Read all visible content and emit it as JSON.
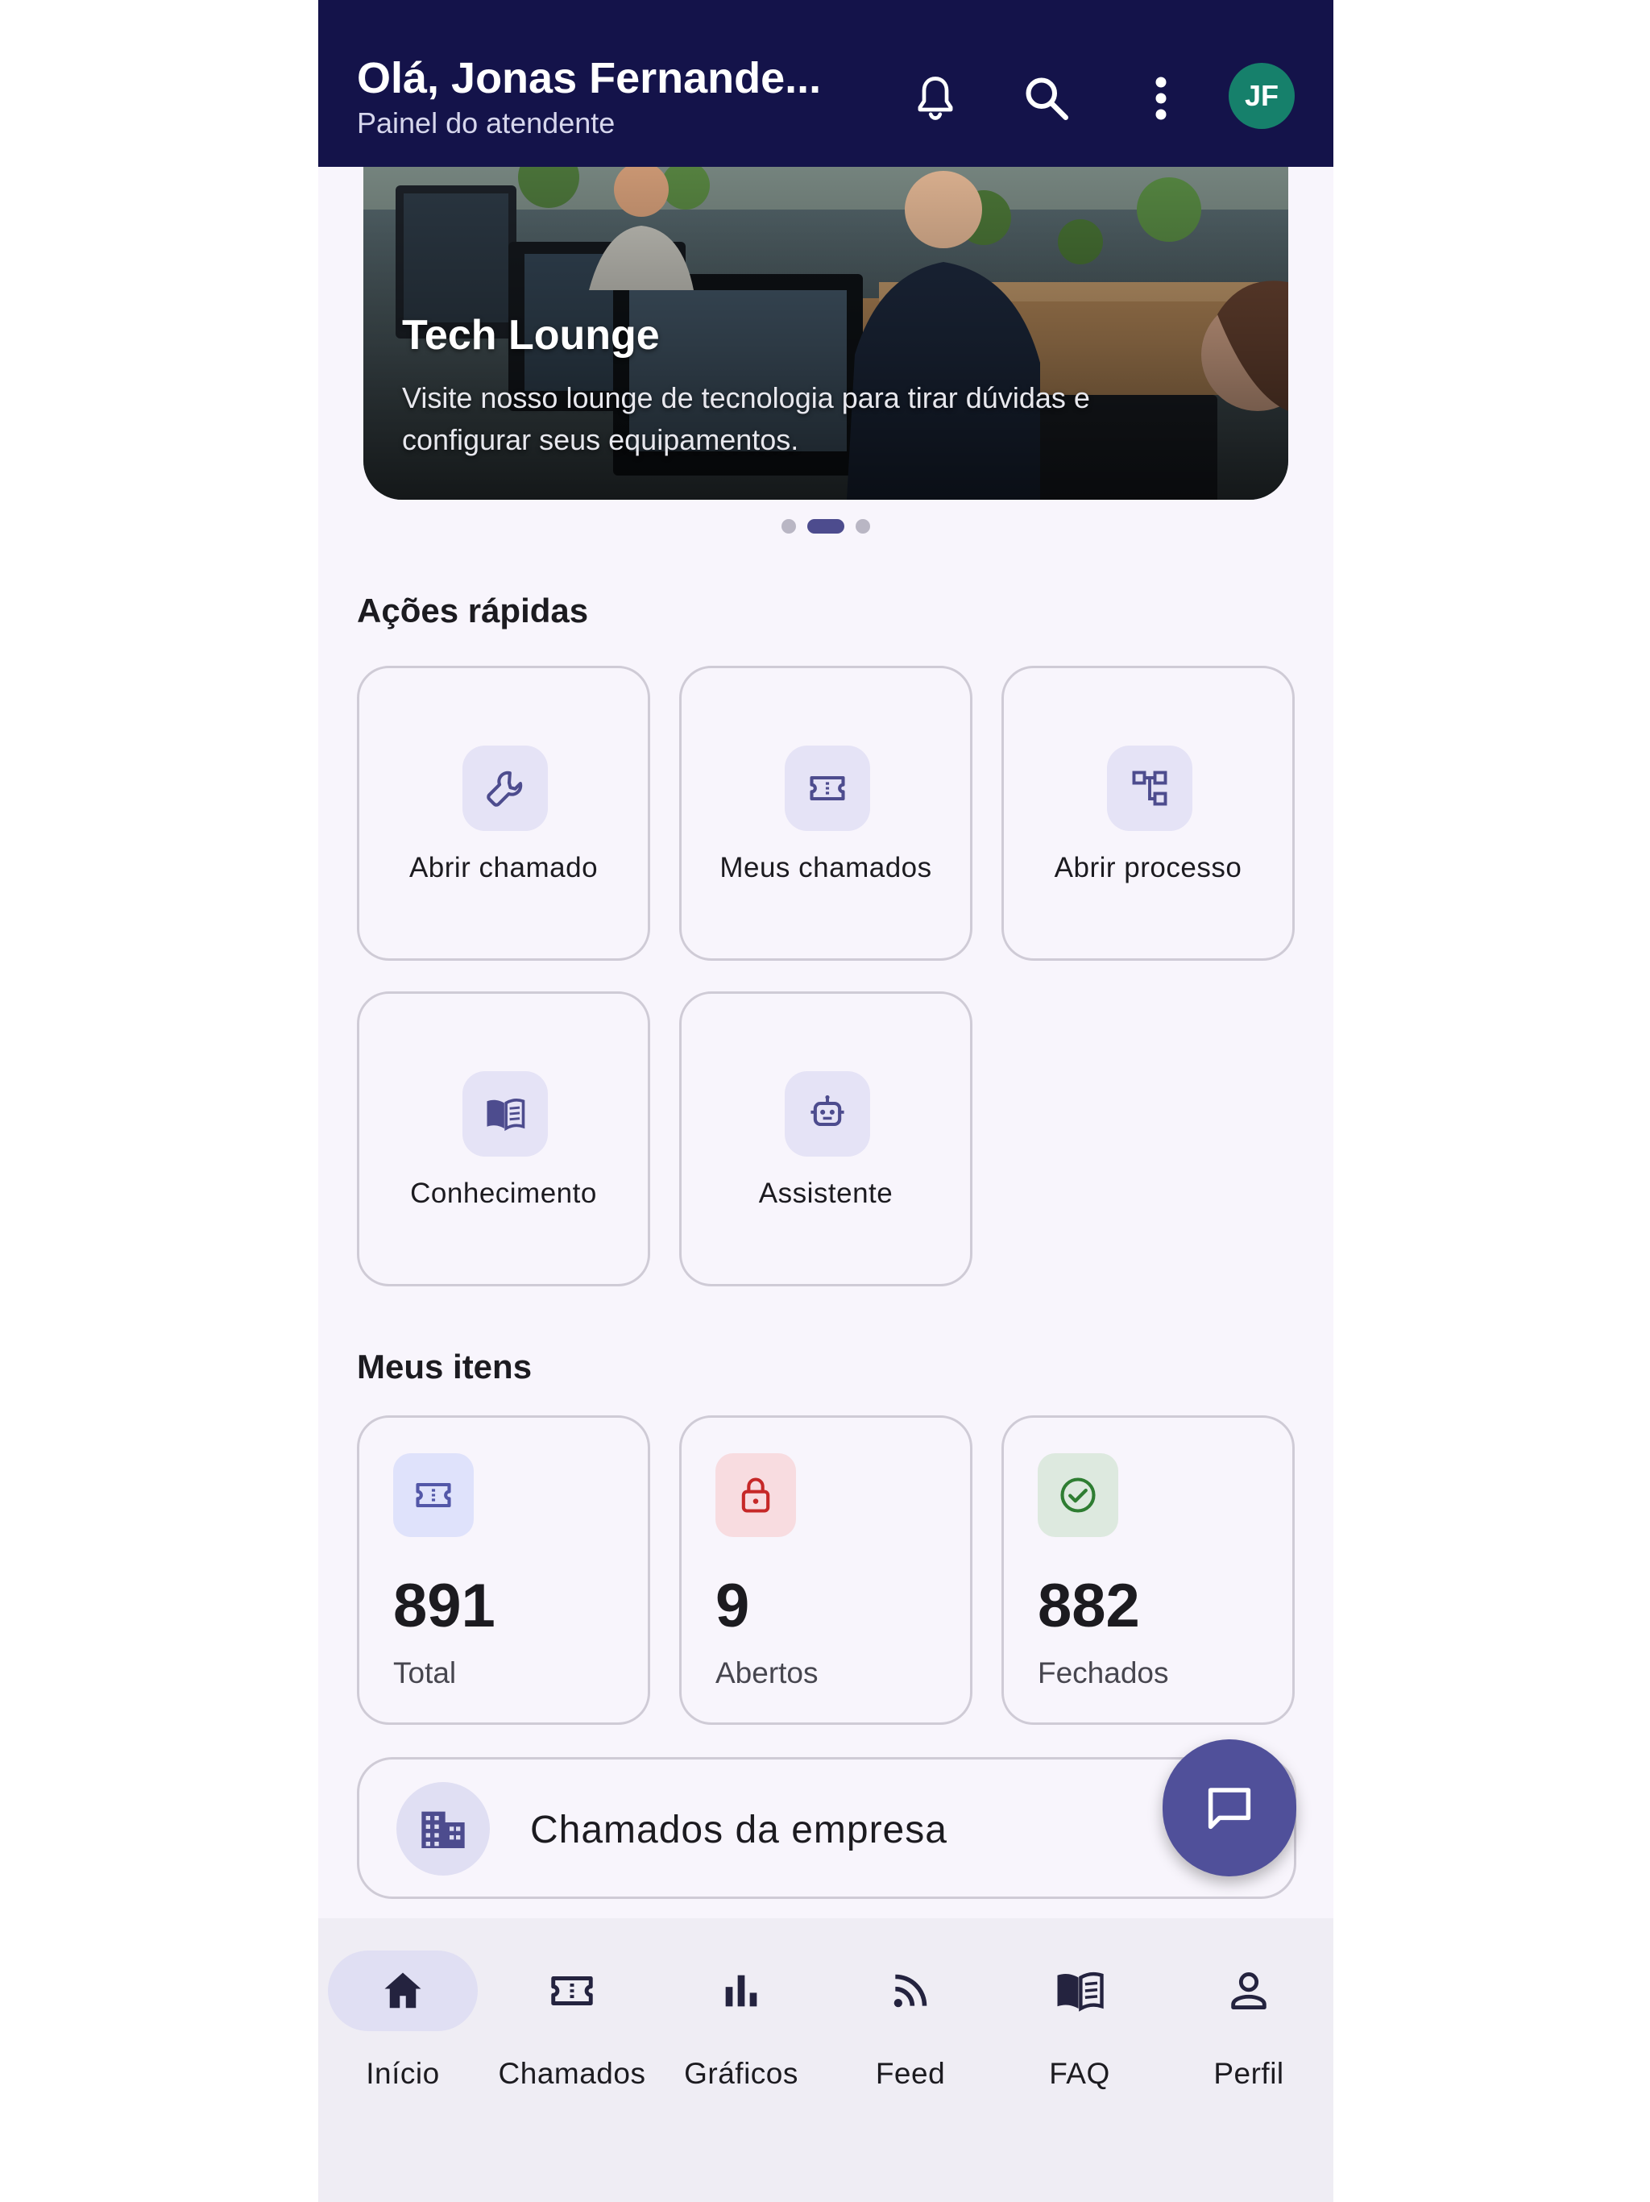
{
  "header": {
    "title": "Olá, Jonas Fernande...",
    "subtitle": "Painel do atendente",
    "avatar_initials": "JF",
    "icons": [
      "bell-icon",
      "search-icon",
      "more-vert-icon"
    ]
  },
  "banner": {
    "title": "Tech Lounge",
    "text": "Visite nosso lounge de tecnologia para tirar dúvidas e configurar seus equipamentos.",
    "image": "office-photo",
    "page_count": 3,
    "active_page": 2
  },
  "quick_actions": {
    "title": "Ações rápidas",
    "items": [
      {
        "label": "Abrir chamado",
        "icon": "wrench-icon"
      },
      {
        "label": "Meus chamados",
        "icon": "ticket-icon"
      },
      {
        "label": "Abrir processo",
        "icon": "workflow-icon"
      },
      {
        "label": "Conhecimento",
        "icon": "book-icon"
      },
      {
        "label": "Assistente",
        "icon": "robot-icon"
      }
    ]
  },
  "my_items": {
    "title": "Meus itens",
    "stats": [
      {
        "value": "891",
        "label": "Total",
        "icon": "ticket-icon",
        "color": "#5357a8",
        "bg": "#dfe2fb"
      },
      {
        "value": "9",
        "label": "Abertos",
        "icon": "lock-open-icon",
        "color": "#c62828",
        "bg": "#f8dce0"
      },
      {
        "value": "882",
        "label": "Fechados",
        "icon": "check-circle-icon",
        "color": "#2e7d32",
        "bg": "#dde9df"
      }
    ]
  },
  "company": {
    "label": "Chamados da empresa",
    "icon": "building-icon"
  },
  "fab": {
    "icon": "chat-icon"
  },
  "bottom_nav": {
    "items": [
      {
        "label": "Início",
        "icon": "home-icon",
        "active": true
      },
      {
        "label": "Chamados",
        "icon": "ticket-icon",
        "active": false
      },
      {
        "label": "Gráficos",
        "icon": "bar-chart-icon",
        "active": false
      },
      {
        "label": "Feed",
        "icon": "rss-icon",
        "active": false
      },
      {
        "label": "FAQ",
        "icon": "book-icon",
        "active": false
      },
      {
        "label": "Perfil",
        "icon": "person-icon",
        "active": false
      }
    ]
  },
  "colors": {
    "appbar": "#14134a",
    "accent": "#50509a",
    "background": "#f8f5fc"
  }
}
